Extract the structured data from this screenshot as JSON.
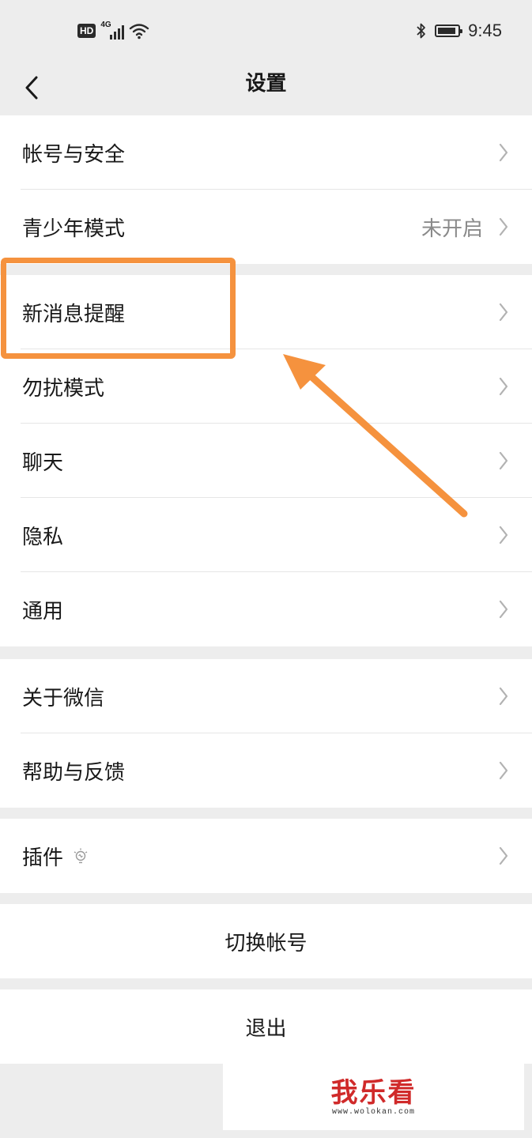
{
  "status_bar": {
    "left_badge": "HD",
    "network": "4G",
    "time": "9:45",
    "icons": [
      "hd-icon",
      "signal-icon",
      "wifi-icon",
      "bluetooth-icon",
      "battery-icon"
    ]
  },
  "nav": {
    "title": "设置",
    "back_icon": "back-arrow-icon"
  },
  "groups": [
    [
      {
        "label": "帐号与安全"
      },
      {
        "label": "青少年模式",
        "value": "未开启"
      }
    ],
    [
      {
        "label": "新消息提醒"
      },
      {
        "label": "勿扰模式"
      },
      {
        "label": "聊天"
      },
      {
        "label": "隐私"
      },
      {
        "label": "通用"
      }
    ],
    [
      {
        "label": "关于微信"
      },
      {
        "label": "帮助与反馈"
      }
    ],
    [
      {
        "label": "插件",
        "icon": "lightbulb-icon"
      }
    ]
  ],
  "buttons": {
    "switch_account": "切换帐号",
    "logout": "退出"
  },
  "annotation": {
    "color": "#f5923e",
    "highlighted_item": "新消息提醒"
  },
  "watermark": {
    "text": "我乐看",
    "url": "www.wolokan.com"
  },
  "colors": {
    "background": "#ededed",
    "card": "#ffffff",
    "text": "#191919",
    "secondary": "#8a8a8a",
    "chevron": "#b2b2b2"
  }
}
